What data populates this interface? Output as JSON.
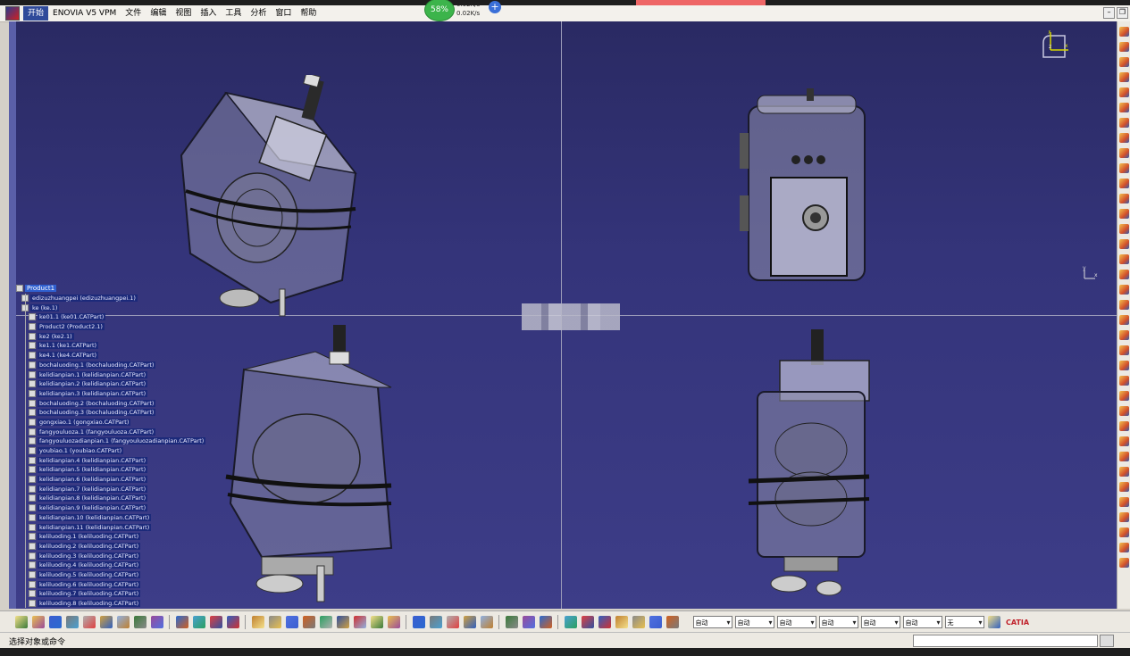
{
  "menu": {
    "items": [
      "开始",
      "ENOVIA V5 VPM",
      "文件",
      "编辑",
      "视图",
      "插入",
      "工具",
      "分析",
      "窗口",
      "帮助"
    ]
  },
  "net_widget": {
    "percent": "58%",
    "up": "0.02K/s",
    "down": "0.02K/s",
    "plus": "+"
  },
  "compass": {
    "x": "x",
    "y": "y",
    "z": "z"
  },
  "axis_small": {
    "y": "y",
    "x": "x"
  },
  "tree": {
    "root": "Product1",
    "items": [
      "edizuzhuangpei (edizuzhuangpei.1)",
      "ke (ke.1)",
      "ke01.1 (ke01.CATPart)",
      "Product2 (Product2.1)",
      "ke2 (ke2.1)",
      "ke1.1 (ke1.CATPart)",
      "ke4.1 (ke4.CATPart)",
      "bochaluoding.1 (bochaluoding.CATPart)",
      "kelidianpian.1 (kelidianpian.CATPart)",
      "kelidianpian.2 (kelidianpian.CATPart)",
      "kelidianpian.3 (kelidianpian.CATPart)",
      "bochaluoding.2 (bochaluoding.CATPart)",
      "bochaluoding.3 (bochaluoding.CATPart)",
      "gongxiao.1 (gongxiao.CATPart)",
      "fangyouluoza.1 (fangyouluoza.CATPart)",
      "fangyouluozadianpian.1 (fangyouluozadianpian.CATPart)",
      "youbiao.1 (youbiao.CATPart)",
      "kelidianpian.4 (kelidianpian.CATPart)",
      "kelidianpian.5 (kelidianpian.CATPart)",
      "kelidianpian.6 (kelidianpian.CATPart)",
      "kelidianpian.7 (kelidianpian.CATPart)",
      "kelidianpian.8 (kelidianpian.CATPart)",
      "kelidianpian.9 (kelidianpian.CATPart)",
      "kelidianpian.10 (kelidianpian.CATPart)",
      "kelidianpian.11 (kelidianpian.CATPart)",
      "keliluoding.1 (keliluoding.CATPart)",
      "keliluoding.2 (keliluoding.CATPart)",
      "keliluoding.3 (keliluoding.CATPart)",
      "keliluoding.4 (keliluoding.CATPart)",
      "keliluoding.5 (keliluoding.CATPart)",
      "keliluoding.6 (keliluoding.CATPart)",
      "keliluoding.7 (keliluoding.CATPart)",
      "keliluoding.8 (keliluoding.CATPart)"
    ]
  },
  "toolbar": {
    "combos": [
      "自动",
      "自动",
      "自动",
      "自动",
      "自动",
      "自动",
      "无"
    ],
    "logo": "CATIA"
  },
  "status": {
    "message": "选择对象或命令"
  },
  "colors": {
    "viewport_top": "#2a2a63",
    "viewport_bottom": "#3d3d88",
    "tree_highlight": "#1c2a7a",
    "menu_active": "#2f4a9a"
  }
}
